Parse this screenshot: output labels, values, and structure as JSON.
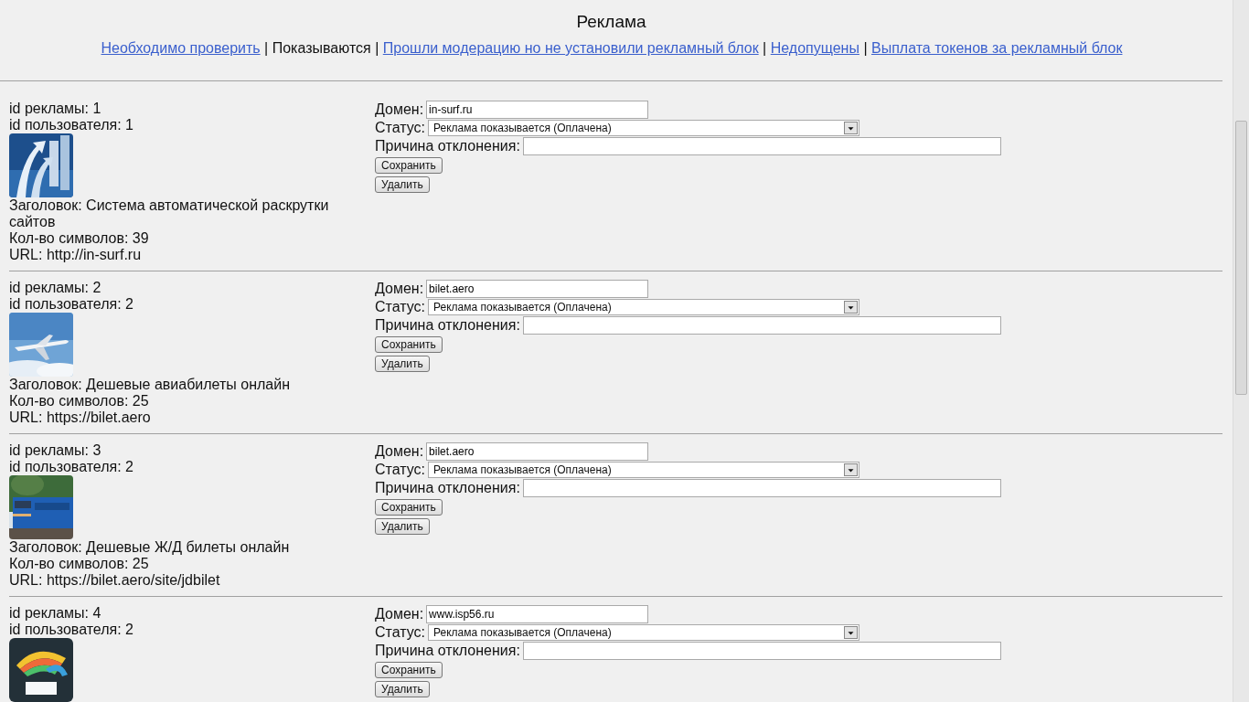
{
  "title": "Реклама",
  "nav": [
    {
      "label": "Необходимо проверить",
      "selected": false
    },
    {
      "label": "Показываются",
      "selected": true
    },
    {
      "label": "Прошли модерацию но не установили рекламный блок",
      "selected": false
    },
    {
      "label": "Недопущены",
      "selected": false
    },
    {
      "label": "Выплата токенов за рекламный блок",
      "selected": false
    }
  ],
  "nav_separator": "|",
  "ads": [
    {
      "ad_id": "id рекламы: 1",
      "user_id": "id пользователя: 1",
      "heading": "Заголовок: Система автоматической раскрутки сайтов",
      "chars": "Кол-во символов: 39",
      "url": "URL: http://in-surf.ru",
      "domain_label": "Домен:",
      "domain": "in-surf.ru",
      "status_label": "Статус:",
      "status": "Реклама показывается (Оплачена)",
      "reason_label": "Причина отклонения:",
      "save": "Сохранить",
      "delete": "Удалить"
    },
    {
      "ad_id": "id рекламы: 2",
      "user_id": "id пользователя: 2",
      "heading": "Заголовок: Дешевые авиабилеты онлайн",
      "chars": "Кол-во символов: 25",
      "url": "URL: https://bilet.aero",
      "domain_label": "Домен:",
      "domain": "bilet.aero",
      "status_label": "Статус:",
      "status": "Реклама показывается (Оплачена)",
      "reason_label": "Причина отклонения:",
      "save": "Сохранить",
      "delete": "Удалить"
    },
    {
      "ad_id": "id рекламы: 3",
      "user_id": "id пользователя: 2",
      "heading": "Заголовок: Дешевые Ж/Д билеты онлайн",
      "chars": "Кол-во символов: 25",
      "url": "URL: https://bilet.aero/site/jdbilet",
      "domain_label": "Домен:",
      "domain": "bilet.aero",
      "status_label": "Статус:",
      "status": "Реклама показывается (Оплачена)",
      "reason_label": "Причина отклонения:",
      "save": "Сохранить",
      "delete": "Удалить"
    },
    {
      "ad_id": "id рекламы: 4",
      "user_id": "id пользователя: 2",
      "domain_label": "Домен:",
      "domain": "www.isp56.ru",
      "status_label": "Статус:",
      "status": "Реклама показывается (Оплачена)",
      "reason_label": "Причина отклонения:",
      "save": "Сохранить",
      "delete": "Удалить"
    }
  ]
}
